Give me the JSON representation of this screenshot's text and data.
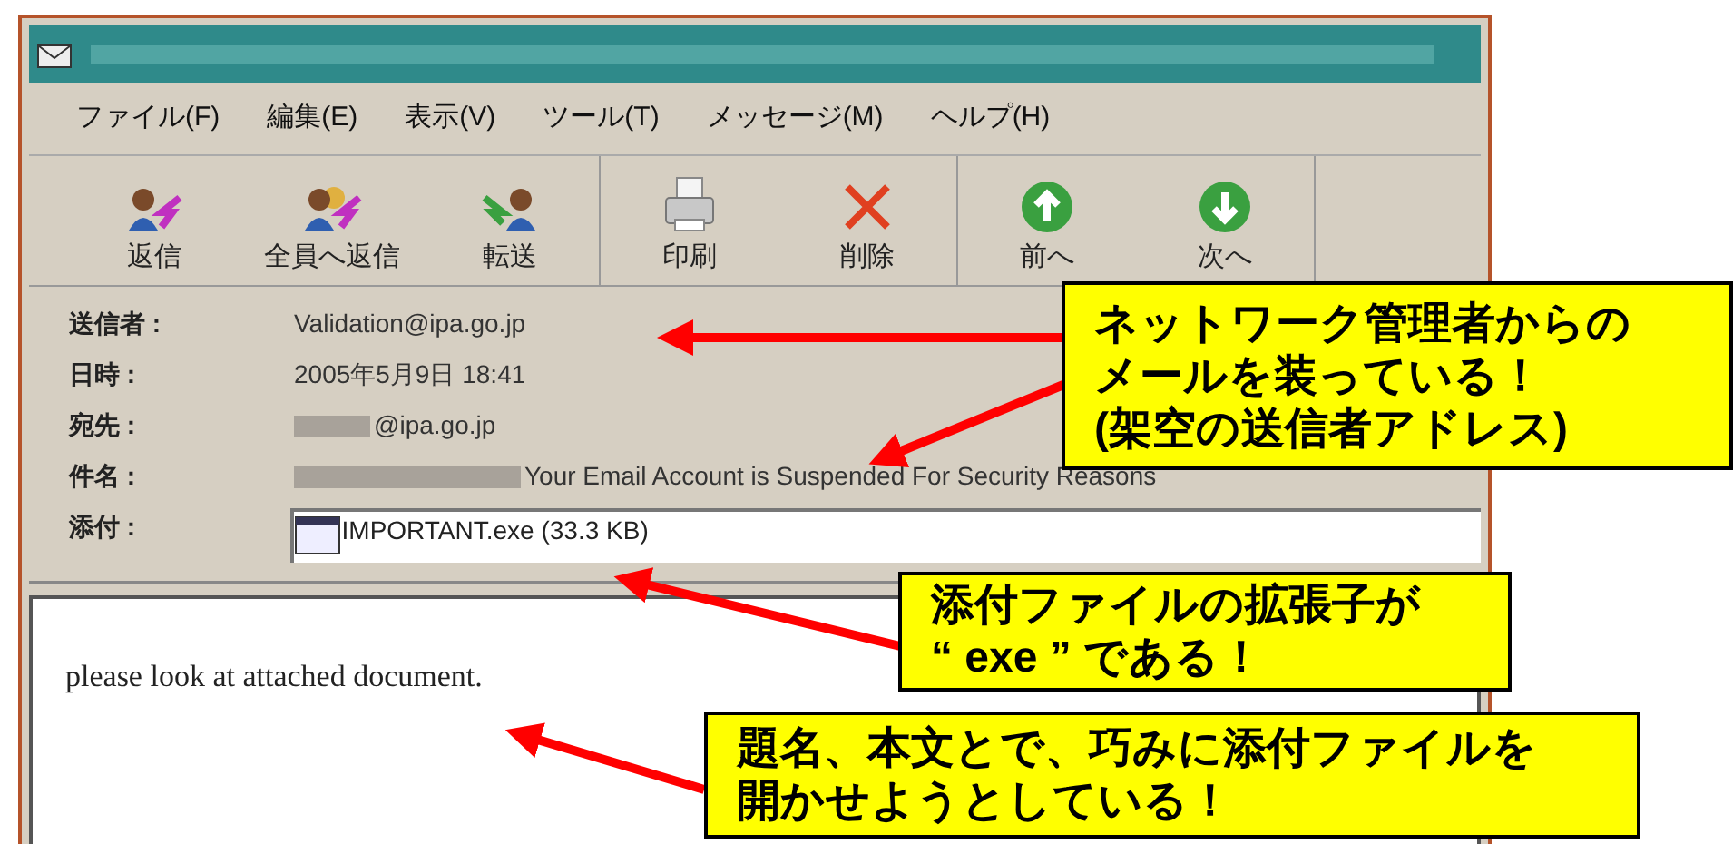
{
  "menu": [
    "ファイル(F)",
    "編集(E)",
    "表示(V)",
    "ツール(T)",
    "メッセージ(M)",
    "ヘルプ(H)"
  ],
  "toolbar": [
    [
      {
        "label": "返信",
        "kind": "reply"
      },
      {
        "label": "全員へ返信",
        "kind": "reply_all"
      },
      {
        "label": "転送",
        "kind": "forward"
      }
    ],
    [
      {
        "label": "印刷",
        "kind": "print"
      },
      {
        "label": "削除",
        "kind": "delete"
      }
    ],
    [
      {
        "label": "前へ",
        "kind": "up"
      },
      {
        "label": "次へ",
        "kind": "down"
      }
    ]
  ],
  "headers": [
    {
      "label": "送信者 :",
      "value": "Validation@ipa.go.jp",
      "kind": "text"
    },
    {
      "label": "日時 :",
      "value": "2005年5月9日 18:41",
      "kind": "text"
    },
    {
      "label": "宛先 :",
      "value": "@ipa.go.jp",
      "kind": "redacted"
    },
    {
      "label": "件名 :",
      "value": "Your Email Account is Suspended For Security Reasons",
      "kind": "redacted"
    },
    {
      "label": "添付 :",
      "value": "IMPORTANT.exe (33.3 KB)",
      "kind": "attachment"
    }
  ],
  "body": "please look at attached document.",
  "callouts": [
    {
      "lines": [
        "ネットワーク管理者からの",
        "メールを装っている！",
        "(架空の送信者アドレス)"
      ]
    },
    {
      "lines": [
        "添付ファイルの拡張子が",
        "“ exe ” である！"
      ]
    },
    {
      "lines": [
        "題名、本文とで、巧みに添付ファイルを",
        "開かせようとしている！"
      ]
    }
  ]
}
